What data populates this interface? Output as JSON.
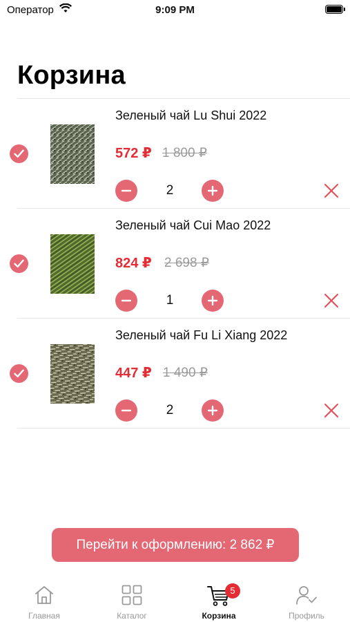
{
  "status_bar": {
    "carrier": "Оператор",
    "time": "9:09 PM"
  },
  "page": {
    "title": "Корзина"
  },
  "cart": {
    "items": [
      {
        "name": "Зеленый чай Lu Shui 2022",
        "price": "572 ₽",
        "old_price": "1 800 ₽",
        "quantity": "2",
        "selected": true
      },
      {
        "name": "Зеленый чай Cui Mao 2022",
        "price": "824 ₽",
        "old_price": "2 698 ₽",
        "quantity": "1",
        "selected": true
      },
      {
        "name": "Зеленый чай Fu Li Xiang 2022",
        "price": "447 ₽",
        "old_price": "1 490 ₽",
        "quantity": "2",
        "selected": true
      }
    ]
  },
  "checkout": {
    "label": "Перейти к оформлению: 2 862 ₽"
  },
  "tab_bar": {
    "tabs": [
      {
        "label": "Главная",
        "icon": "home-icon"
      },
      {
        "label": "Каталог",
        "icon": "grid-icon"
      },
      {
        "label": "Корзина",
        "icon": "cart-icon",
        "active": true
      },
      {
        "label": "Профиль",
        "icon": "profile-icon"
      }
    ],
    "cart_badge": "5"
  },
  "colors": {
    "accent": "#e46874",
    "price_red": "#e32c34",
    "muted": "#9a9a9a"
  }
}
